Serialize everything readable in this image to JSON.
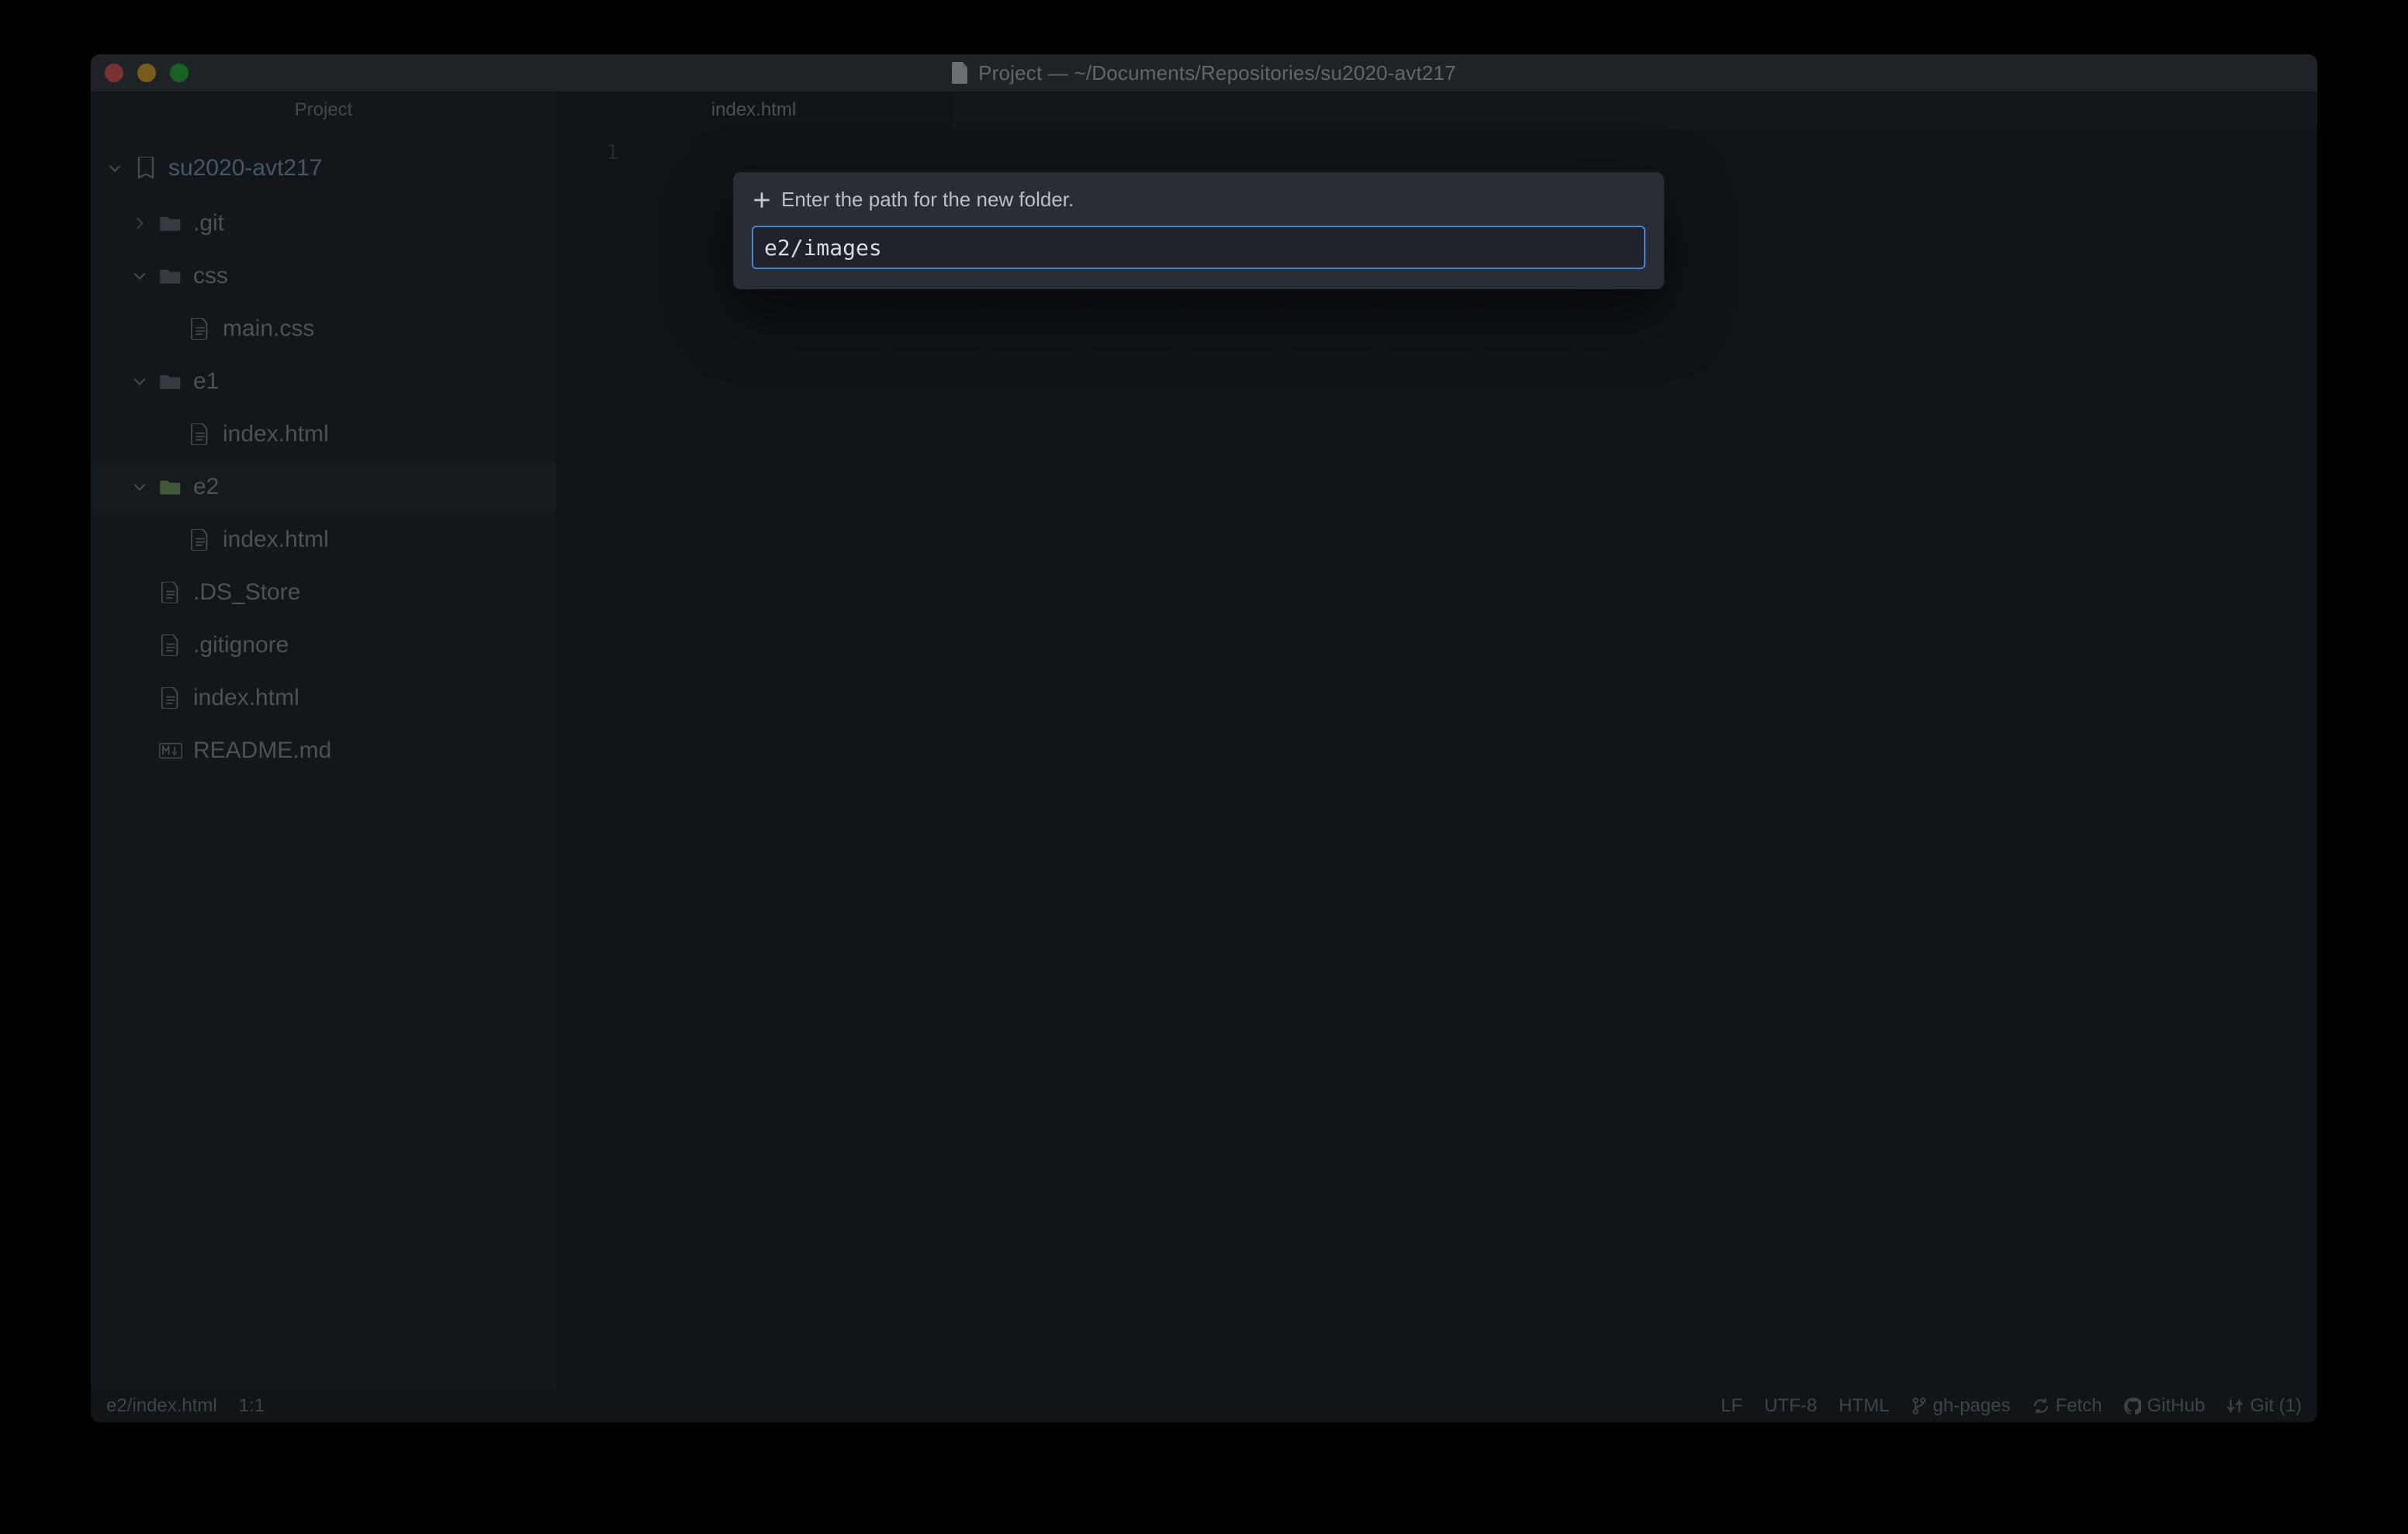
{
  "window": {
    "title": "Project — ~/Documents/Repositories/su2020-avt217"
  },
  "sidebar": {
    "header": "Project",
    "root": "su2020-avt217",
    "git_folder": ".git",
    "css_folder": "css",
    "css_file": "main.css",
    "e1_folder": "e1",
    "e1_file": "index.html",
    "e2_folder": "e2",
    "e2_file": "index.html",
    "dsstore": ".DS_Store",
    "gitignore": ".gitignore",
    "root_index": "index.html",
    "readme": "README.md"
  },
  "tabs": {
    "tab1": "index.html"
  },
  "editor": {
    "first_line_number": "1"
  },
  "dialog": {
    "prompt": "Enter the path for the new folder.",
    "value": "e2/images"
  },
  "status": {
    "filepath": "e2/index.html",
    "cursor": "1:1",
    "eol": "LF",
    "encoding": "UTF-8",
    "language": "HTML",
    "branch": "gh-pages",
    "fetch": "Fetch",
    "github": "GitHub",
    "git": "Git (1)"
  }
}
